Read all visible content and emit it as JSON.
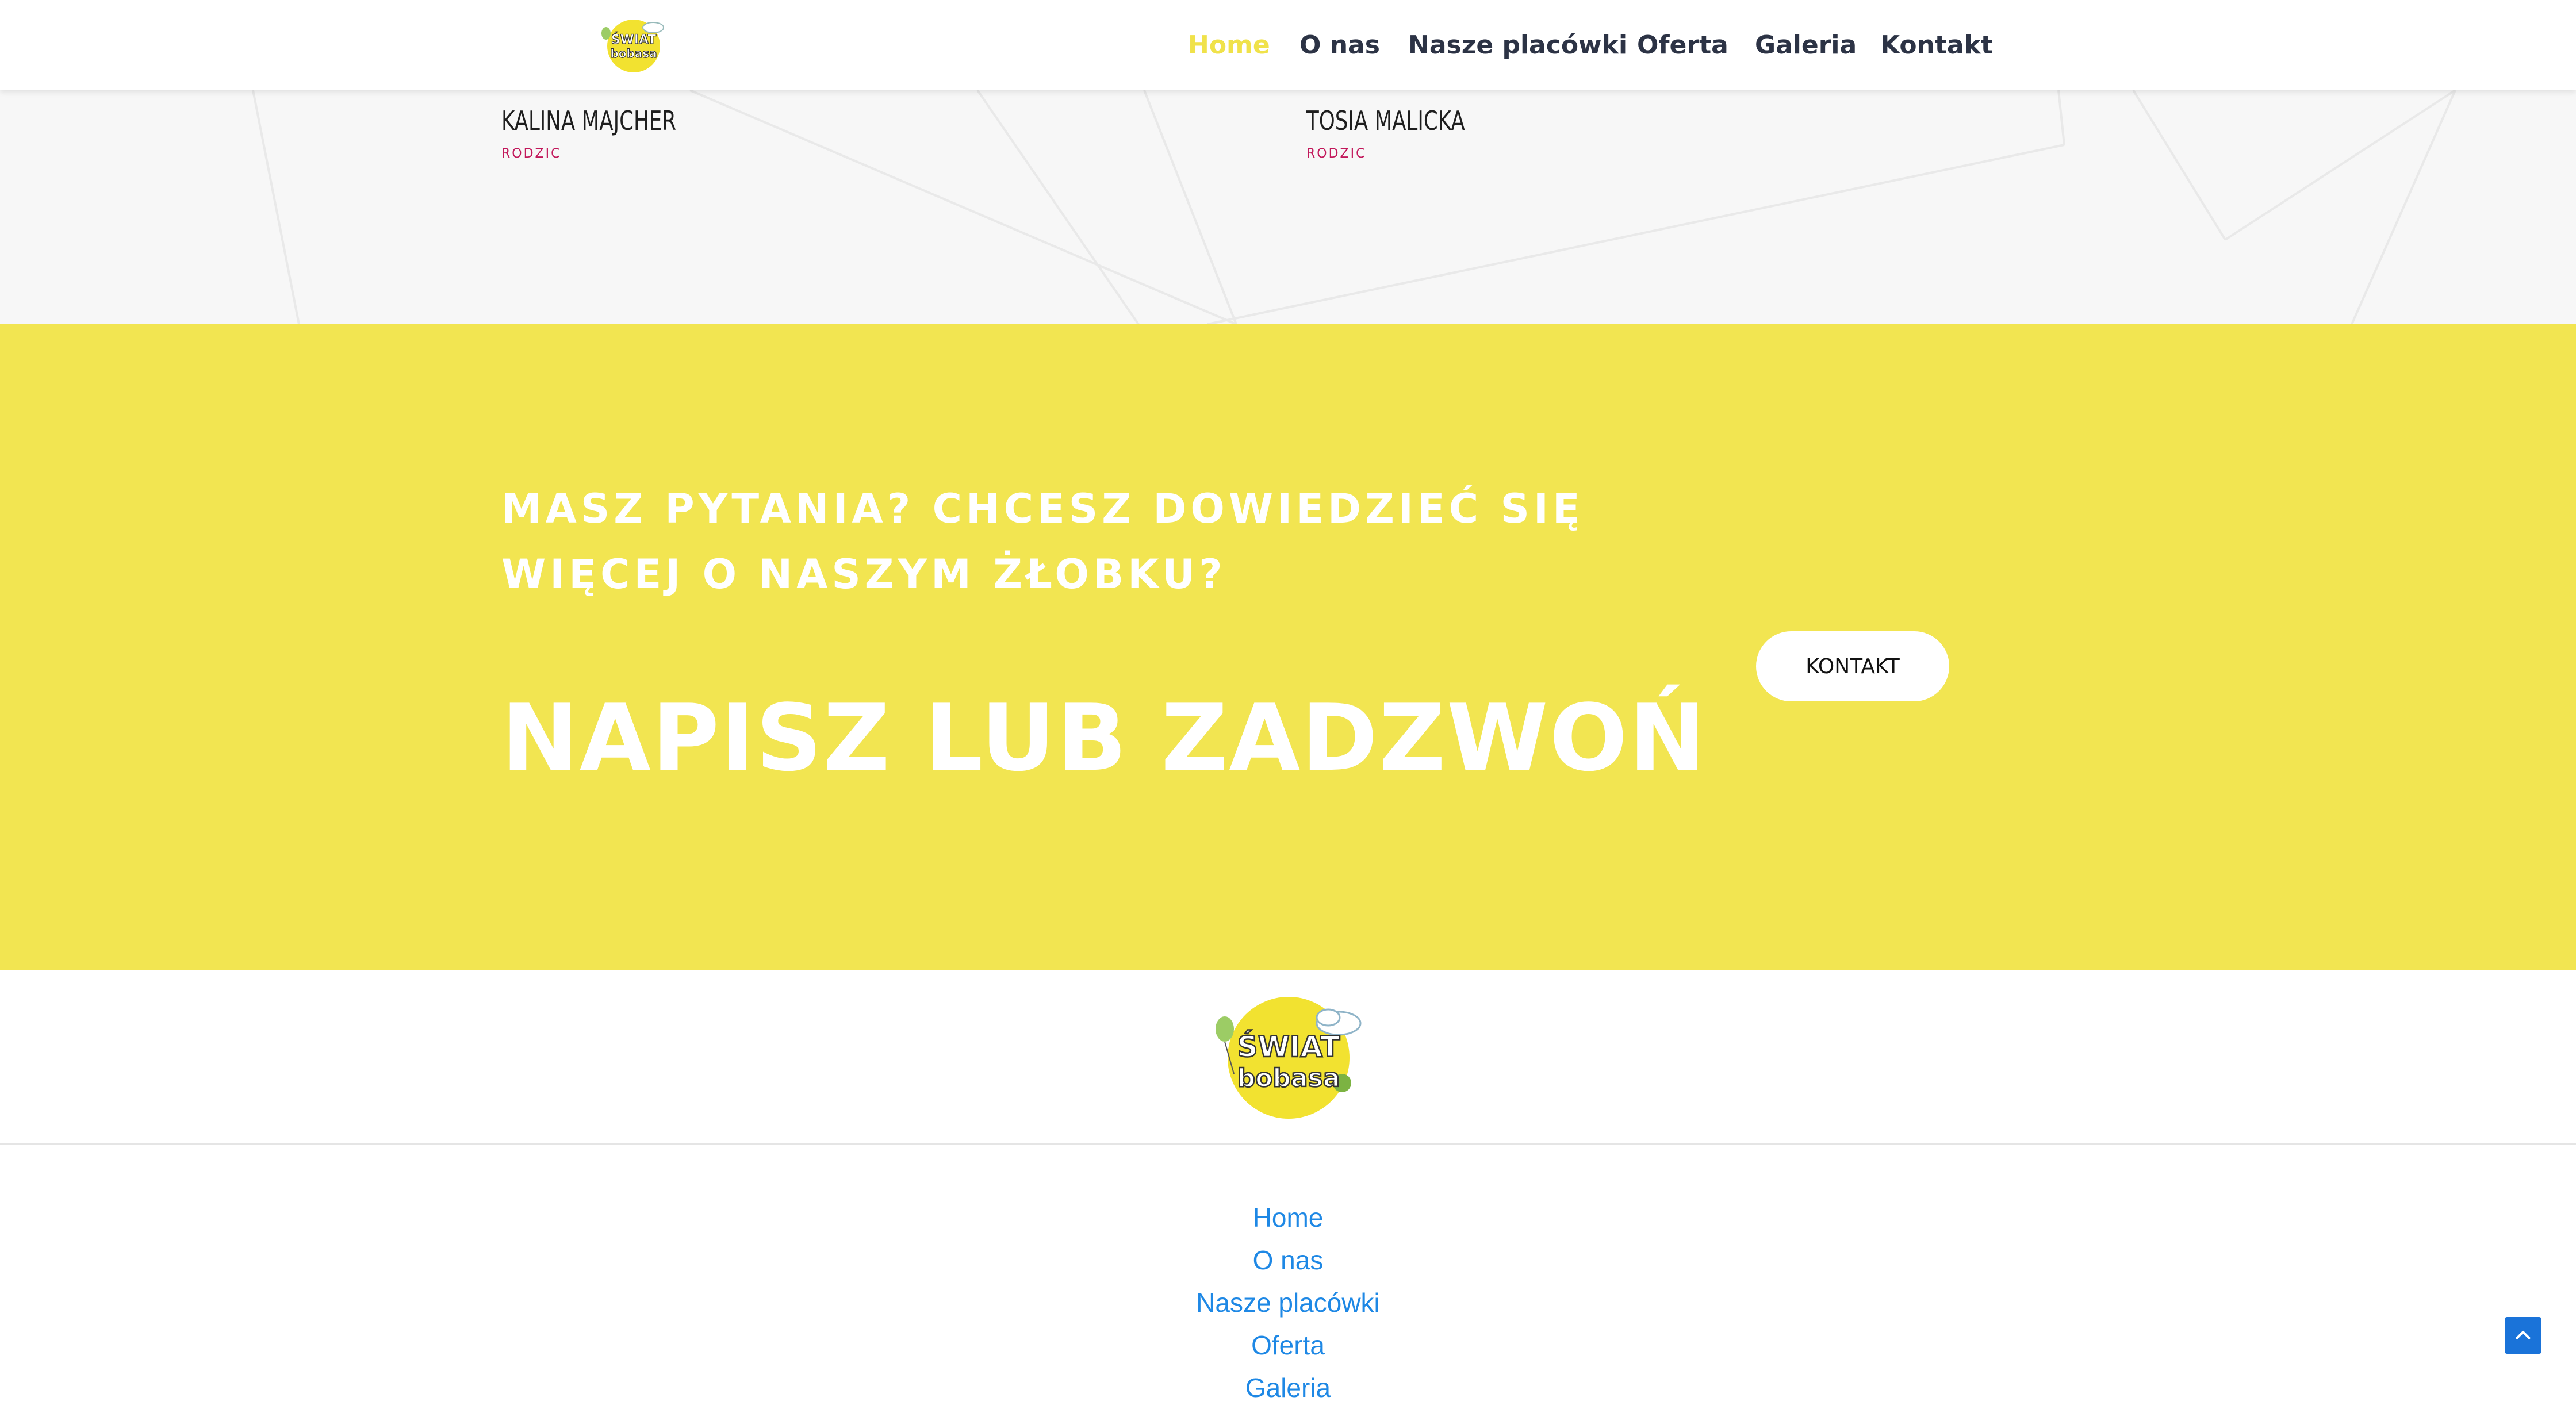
{
  "header": {
    "logo_text_top": "ŚWIAT",
    "logo_text_bottom": "bobasa",
    "nav": [
      {
        "label": "Home",
        "active": true
      },
      {
        "label": "O nas",
        "active": false
      },
      {
        "label": "Nasze placówki",
        "active": false
      },
      {
        "label": "Oferta",
        "active": false
      },
      {
        "label": "Galeria",
        "active": false
      },
      {
        "label": "Kontakt",
        "active": false
      }
    ]
  },
  "testimonials": [
    {
      "name": "KALINA MAJCHER",
      "role": "RODZIC"
    },
    {
      "name": "TOSIA MALICKA",
      "role": "RODZIC"
    }
  ],
  "cta": {
    "question_line1": "MASZ PYTANIA? CHCESZ DOWIEDZIEĆ SIĘ",
    "question_line2": "WIĘCEJ O NASZYM ŻŁOBKU?",
    "heading": "NAPISZ LUB ZADZWOŃ",
    "button_label": "KONTAKT"
  },
  "footer": {
    "logo_text_top": "ŚWIAT",
    "logo_text_bottom": "bobasa",
    "links": [
      "Home",
      "O nas",
      "Nasze placówki",
      "Oferta",
      "Galeria"
    ]
  },
  "colors": {
    "accent_yellow": "#f2e551",
    "nav_active": "#f0e24a",
    "nav_text": "#2c3345",
    "role_pink": "#c2185b",
    "footer_link": "#1e88e5",
    "scroll_button": "#1a73d9"
  },
  "icons": {
    "scroll_top": "chevron-up-icon"
  }
}
